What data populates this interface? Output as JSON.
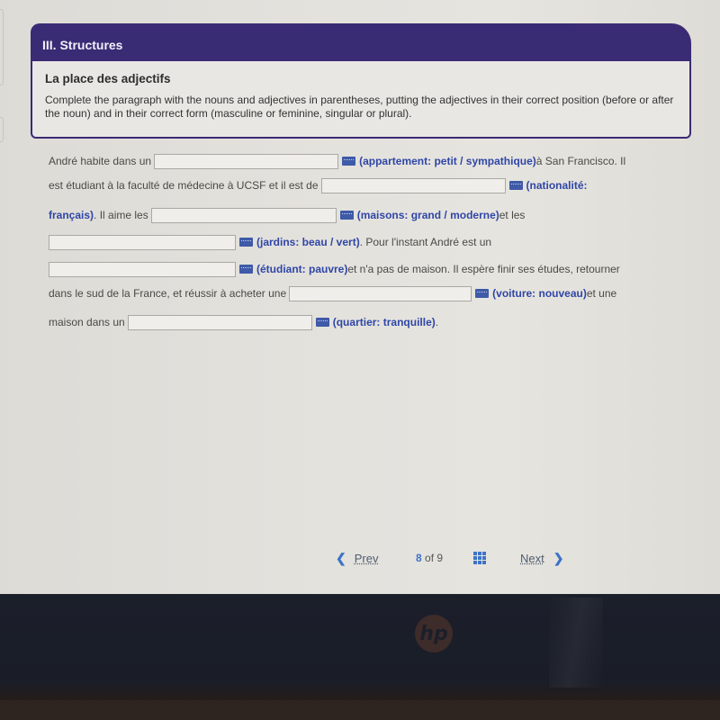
{
  "section": {
    "header": "III. Structures",
    "title": "La place des adjectifs",
    "instructions": "Complete the paragraph with the nouns and adjectives in parentheses, putting the adjectives in their correct position (before or after the noun) and in their correct form (masculine or feminine, singular or plural)."
  },
  "paragraph": {
    "l1_before": "André habite dans un",
    "blank1": {
      "value": "",
      "hint": "(appartement: petit / sympathique)"
    },
    "l1_after": " à San Francisco. Il",
    "l2_before": "est étudiant à la faculté de médecine à UCSF et il est de",
    "blank2": {
      "value": "",
      "hint": "(nationalité:"
    },
    "l3_hint_cont": "français)",
    "l3_mid": ". Il aime les",
    "blank3": {
      "value": "",
      "hint": "(maisons: grand / moderne)"
    },
    "l3_after": " et les",
    "blank4": {
      "value": "",
      "hint": "(jardins: beau / vert)"
    },
    "l4_after": ". Pour l'instant André est un",
    "blank5": {
      "value": "",
      "hint": "(étudiant: pauvre)"
    },
    "l5_after": " et n'a pas de maison. Il espère finir ses études, retourner",
    "l6_before": "dans le sud de la France, et réussir à acheter une",
    "blank6": {
      "value": "",
      "hint": "(voiture: nouveau)"
    },
    "l6_after": " et une",
    "l7_before": "maison dans un",
    "blank7": {
      "value": "",
      "hint": "(quartier: tranquille)"
    },
    "l7_after": "."
  },
  "pager": {
    "prev_label": "Prev",
    "current": "8",
    "of_label": "of",
    "total": "9",
    "next_label": "Next"
  },
  "device": {
    "logo": "hp"
  },
  "colors": {
    "header_bg": "#3a2b75",
    "hint_text": "#2f46a7",
    "pager_accent": "#3d73c7"
  }
}
